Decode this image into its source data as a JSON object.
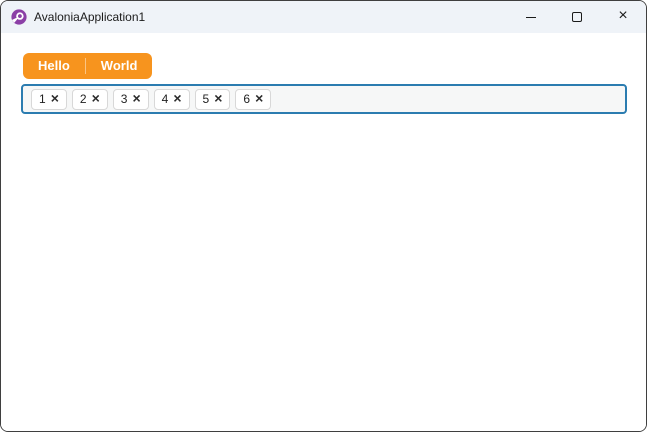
{
  "window": {
    "title": "AvaloniaApplication1",
    "icons": {
      "logo": "avalonia-logo",
      "close": "×"
    },
    "colors": {
      "titlebar_bg": "#EFF3F8",
      "window_border": "#3F3F3F",
      "logo_purple": "#8B3FA6"
    }
  },
  "tabstrip": {
    "accent_color": "#F7941E",
    "tabs": [
      {
        "label": "Hello"
      },
      {
        "label": "World"
      }
    ]
  },
  "chips": {
    "focus_border_color": "#2B7CB0",
    "remove_glyph": "×",
    "items": [
      {
        "label": "1"
      },
      {
        "label": "2"
      },
      {
        "label": "3"
      },
      {
        "label": "4"
      },
      {
        "label": "5"
      },
      {
        "label": "6"
      }
    ]
  }
}
